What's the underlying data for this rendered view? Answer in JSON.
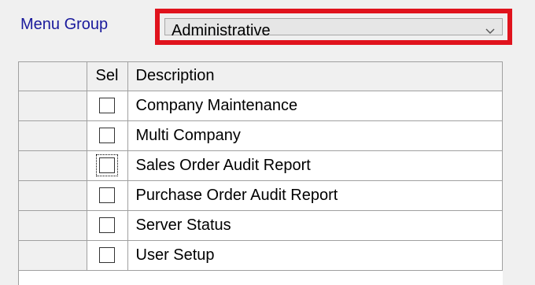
{
  "menu_group": {
    "label": "Menu Group",
    "selected_value": "Administrative",
    "highlight_color": "#e0131d"
  },
  "grid": {
    "columns": [
      "",
      "Sel",
      "Description"
    ],
    "rows": [
      {
        "selected": false,
        "description": "Company Maintenance"
      },
      {
        "selected": false,
        "description": "Multi Company"
      },
      {
        "selected": false,
        "description": "Sales Order Audit Report",
        "focused": true
      },
      {
        "selected": false,
        "description": "Purchase Order Audit Report"
      },
      {
        "selected": false,
        "description": "Server Status"
      },
      {
        "selected": false,
        "description": "User Setup"
      }
    ]
  }
}
